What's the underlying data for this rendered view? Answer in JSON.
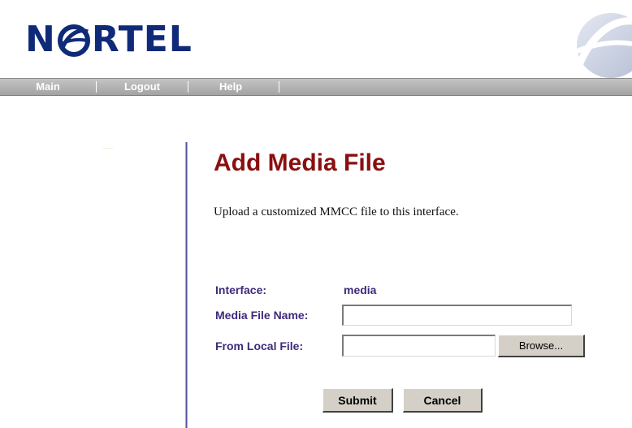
{
  "brand": {
    "logo_prefix": "N",
    "logo_suffix": "RTEL",
    "logo_color": "#0f2a77"
  },
  "nav": {
    "items": [
      {
        "label": "Main"
      },
      {
        "label": "Logout"
      },
      {
        "label": "Help"
      }
    ]
  },
  "main": {
    "title": "Add Media File",
    "title_color": "#8a0f0f",
    "description": "Upload a customized MMCC file to this interface.",
    "form": {
      "interface_label": "Interface:",
      "interface_value": "media",
      "media_file_name_label": "Media File Name:",
      "media_file_name_value": "",
      "from_local_file_label": "From Local File:",
      "from_local_file_value": "",
      "browse_label": "Browse...",
      "submit_label": "Submit",
      "cancel_label": "Cancel"
    },
    "label_color": "#3d2a7a"
  }
}
